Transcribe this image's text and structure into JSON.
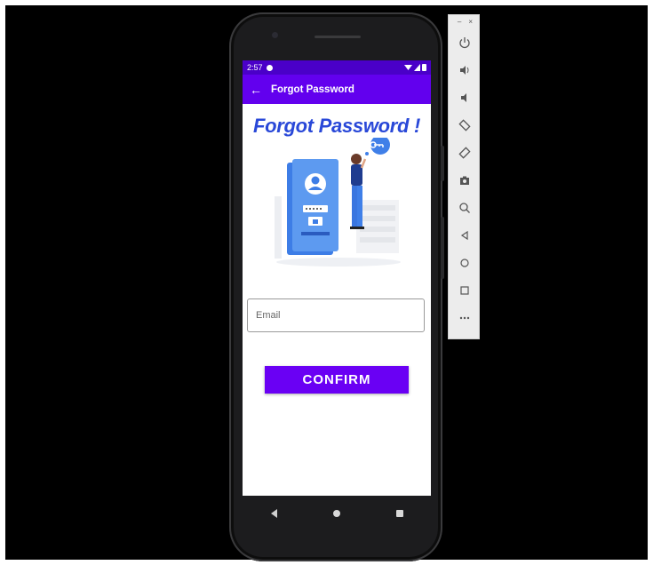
{
  "status_bar": {
    "time": "2:57"
  },
  "app_bar": {
    "title": "Forgot Password",
    "back_icon": "arrow-left-icon"
  },
  "content": {
    "headline": "Forgot Password !",
    "email_placeholder": "Email",
    "email_value": "",
    "confirm_label": "CONFIRM"
  },
  "colors": {
    "status_bar": "#4a00c8",
    "app_bar": "#6200ee",
    "headline": "#2948d8",
    "button": "#6a00f4"
  },
  "emulator_toolbar": {
    "window_controls": [
      "–",
      "×"
    ],
    "tools": [
      "power-icon",
      "volume-up-icon",
      "volume-down-icon",
      "rotate-left-icon",
      "rotate-right-icon",
      "camera-icon",
      "zoom-icon",
      "back-icon",
      "home-icon",
      "overview-icon",
      "more-icon"
    ]
  }
}
